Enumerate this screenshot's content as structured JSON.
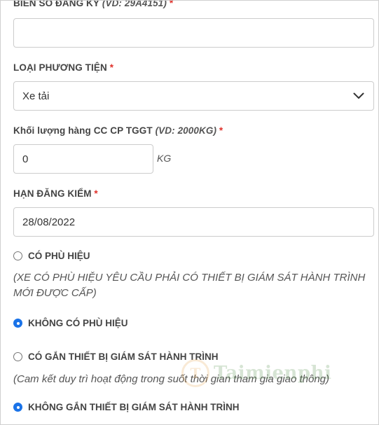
{
  "plate": {
    "label": "BIỂN SỐ ĐĂNG KÝ",
    "hint": "(VD: 29A4151)",
    "required_mark": "*",
    "value": ""
  },
  "vehicle_type": {
    "label": "LOẠI PHƯƠNG TIỆN",
    "required_mark": "*",
    "selected": "Xe tải"
  },
  "cargo_weight": {
    "label": "Khối lượng hàng CC CP TGGT",
    "hint": "(VD: 2000KG)",
    "required_mark": "*",
    "value": "0",
    "unit": "KG"
  },
  "inspection_deadline": {
    "label": "HẠN ĐĂNG KIỂM",
    "required_mark": "*",
    "value": "28/08/2022"
  },
  "badge_options": {
    "has_badge": {
      "label": "CÓ PHÙ HIỆU",
      "checked": false
    },
    "has_badge_note": "(XE CÓ PHÙ HIỆU YÊU CẦU PHẢI CÓ THIẾT BỊ GIÁM SÁT HÀNH TRÌNH MỚI ĐƯỢC CẤP)",
    "no_badge": {
      "label": "KHÔNG CÓ PHÙ HIỆU",
      "checked": true
    }
  },
  "tracker_options": {
    "has_tracker": {
      "label": "CÓ GẮN THIẾT BỊ GIÁM SÁT HÀNH TRÌNH",
      "checked": false
    },
    "has_tracker_note": "(Cam kết duy trì hoạt động trong suốt thời gian tham gia giao thông)",
    "no_tracker": {
      "label": "KHÔNG GẮN THIẾT BỊ GIÁM SÁT HÀNH TRÌNH",
      "checked": true
    }
  },
  "watermark": {
    "logo_letter": "T",
    "text": "Taimienphi"
  },
  "colors": {
    "required": "#e0312b",
    "accent": "#1a73e8",
    "border": "#cccccc"
  },
  "icons": {
    "select_arrow": "chevron-down-icon"
  }
}
